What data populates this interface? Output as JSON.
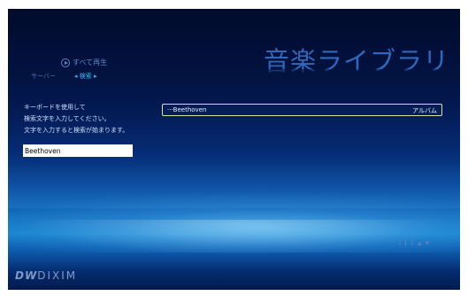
{
  "header": {
    "title": "音楽ライブラリ",
    "play_all": "すべて再生"
  },
  "nav": {
    "server": "サーバー",
    "search": "◂ 検索 ▸"
  },
  "instructions": {
    "line1": "キーボードを使用して",
    "line2": "検索文字を入力してください。",
    "line3": "文字を入力すると検索が始まります。"
  },
  "search": {
    "value": "Beethoven"
  },
  "results": [
    {
      "name": "···Beethoven",
      "type": "アルバム"
    }
  ],
  "pager": {
    "current": "1",
    "total": "1",
    "up": "▲",
    "down": "▼"
  },
  "brand": {
    "mark": "DW",
    "name": "DIXIM"
  },
  "colors": {
    "title": "#2f68b8",
    "accent": "#4ab0ff",
    "selection_border": "#d7e2a8"
  }
}
